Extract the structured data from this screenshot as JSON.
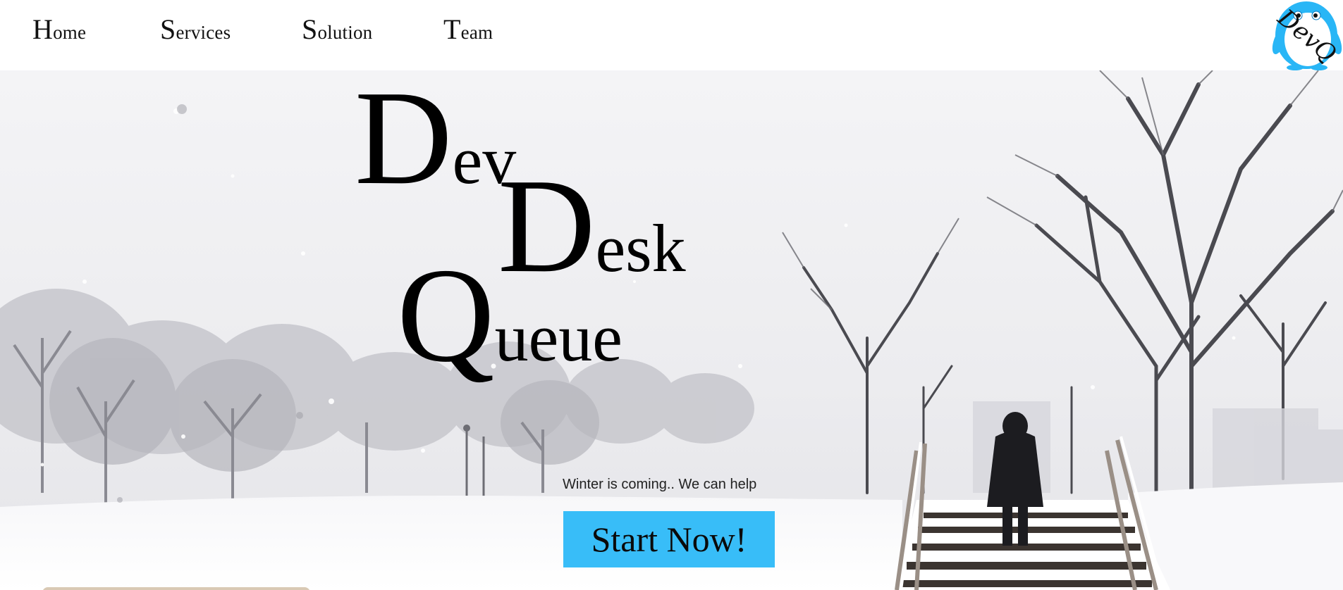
{
  "nav": {
    "items": [
      {
        "label": "Home"
      },
      {
        "label": "Services"
      },
      {
        "label": "Solution"
      },
      {
        "label": "Team"
      }
    ],
    "logo_text": "DevQ"
  },
  "hero": {
    "title_words": [
      {
        "cap": "D",
        "rest": "ev"
      },
      {
        "cap": "D",
        "rest": "esk"
      },
      {
        "cap": "Q",
        "rest": "ueue"
      }
    ],
    "tagline": "Winter is coming.. We can help",
    "cta_label": "Start Now!"
  },
  "colors": {
    "accent": "#38bdf8",
    "logo_blue": "#29b6f6"
  },
  "icons": {
    "logo": "penguin-logo-icon"
  }
}
